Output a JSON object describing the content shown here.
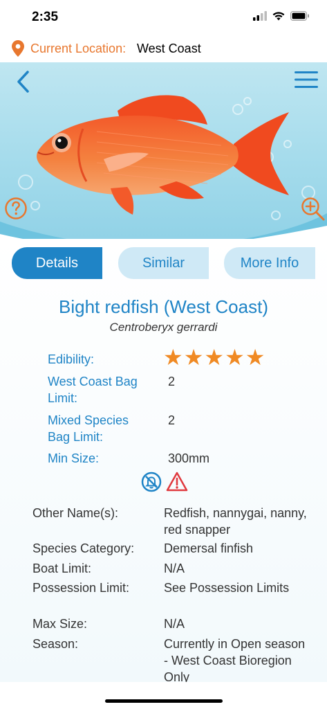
{
  "status": {
    "time": "2:35"
  },
  "location": {
    "label": "Current Location:",
    "value": "West Coast"
  },
  "tabs": {
    "details": "Details",
    "similar": "Similar",
    "more_info": "More Info"
  },
  "fish": {
    "common_name": "Bight redfish (West Coast)",
    "scientific_name": "Centroberyx gerrardi",
    "edibility_label": "Edibility:",
    "edibility_rating": 5,
    "bag_limit_label_1": "West Coast Bag",
    "bag_limit_label_2": "Limit:",
    "bag_limit_value": "2",
    "mixed_label_1": "Mixed Species",
    "mixed_label_2": "Bag Limit:",
    "mixed_value": "2",
    "min_size_label": "Min Size:",
    "min_size_value": "300mm"
  },
  "details": [
    {
      "label": "Other Name(s):",
      "value": "Redfish, nannygai, nanny, red snapper"
    },
    {
      "label": "Species Category:",
      "value": "Demersal finfish"
    },
    {
      "label": "Boat Limit:",
      "value": "N/A"
    },
    {
      "label": "Possession Limit:",
      "value": "See Possession Limits"
    },
    {
      "label": "Max Size:",
      "value": "N/A"
    },
    {
      "label": "Season:",
      "value": "Currently in Open season - West Coast Bioregion Only"
    }
  ],
  "colors": {
    "accent": "#1f84c6",
    "location": "#e8772e",
    "star": "#f08a24",
    "warning": "#e0393e"
  },
  "icons": [
    "location-pin-icon",
    "back-chevron-icon",
    "menu-icon",
    "help-icon",
    "zoom-in-icon",
    "no-notifications-icon",
    "warning-icon",
    "star-icon"
  ]
}
